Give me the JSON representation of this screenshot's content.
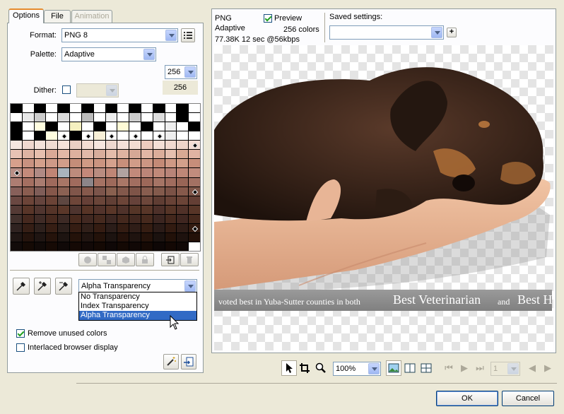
{
  "tabs": [
    {
      "label": "Options"
    },
    {
      "label": "File"
    },
    {
      "label": "Animation"
    }
  ],
  "options": {
    "format_label": "Format:",
    "format_value": "PNG 8",
    "palette_label": "Palette:",
    "palette_value": "Adaptive",
    "colors_value": "256",
    "colors_count": "256",
    "dither_label": "Dither:",
    "transparency_value": "Alpha Transparency",
    "transparency_options": [
      "No Transparency",
      "Index Transparency",
      "Alpha Transparency"
    ],
    "remove_unused_label": "Remove unused colors",
    "interlaced_label": "Interlaced browser display"
  },
  "preview": {
    "format": "PNG",
    "palette": "Adaptive",
    "size_time": "77.38K  12 sec @56kbps",
    "preview_label": "Preview",
    "colors_text": "256 colors",
    "saved_settings_label": "Saved settings:"
  },
  "banner": {
    "small": "voted best in Yuba-Sutter counties in both",
    "large": "Best Veterinarian",
    "and": "and",
    "large2": "Best H"
  },
  "toolbar": {
    "zoom": "100%",
    "frame": "1"
  },
  "buttons": {
    "ok": "OK",
    "cancel": "Cancel"
  },
  "colors": {
    "accent": "#316ac5",
    "tab_active": "#e68b2c",
    "panel": "#fcfcfe",
    "bg": "#ece9d8"
  }
}
